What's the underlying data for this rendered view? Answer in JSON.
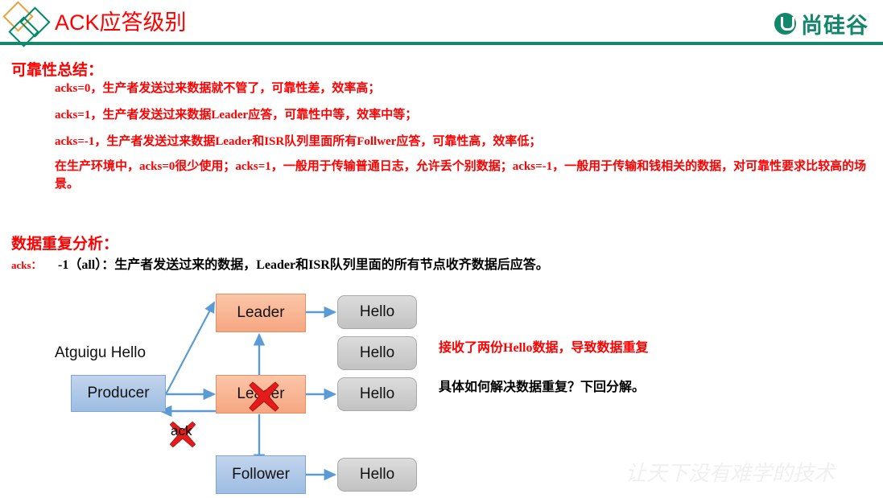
{
  "header": {
    "title": "ACK应答级别",
    "brand_text": "尚硅谷",
    "logo_icon": "diamond-logo-icon",
    "brand_icon": "atguigu-u-icon"
  },
  "sections": {
    "reliability": {
      "heading": "可靠性总结：",
      "lines": [
        "acks=0，生产者发送过来数据就不管了，可靠性差，效率高；",
        "acks=1，生产者发送过来数据Leader应答，可靠性中等，效率中等；",
        "acks=-1，生产者发送过来数据Leader和ISR队列里面所有Follwer应答，可靠性高，效率低；",
        "在生产环境中，acks=0很少使用；acks=1，一般用于传输普通日志，允许丢个别数据；acks=-1，一般用于传输和钱相关的数据，对可靠性要求比较高的场景。"
      ]
    },
    "duplication": {
      "heading": "数据重复分析：",
      "acks_label": "acks：",
      "acks_value": "-1（all）：生产者发送过来的数据，Leader和ISR队列里面的所有节点收齐数据后应答。"
    }
  },
  "diagram": {
    "producer_input_label": "Atguigu Hello",
    "ack_label": "ack",
    "nodes": {
      "producer": "Producer",
      "leader_top": "Leader",
      "leader_mid": "Leader",
      "follower": "Follower"
    },
    "messages": {
      "hello_1": "Hello",
      "hello_2": "Hello",
      "hello_3": "Hello",
      "hello_4": "Hello"
    },
    "x_marks": [
      "x-mark-on-leader-icon",
      "x-mark-on-ack-icon"
    ],
    "colors": {
      "orange": "#F6A681",
      "blue": "#9DBDE2",
      "grey": "#C2C2C2",
      "arrow": "#5B9BD5",
      "x_red": "#E31C1C",
      "accent_green": "#12876B",
      "title_red": "#FF0000"
    }
  },
  "annotations": {
    "note_red": "接收了两份Hello数据，导致数据重复",
    "note_black": "具体如何解决数据重复？下回分解。"
  },
  "watermark": "让天下没有难学的技术"
}
